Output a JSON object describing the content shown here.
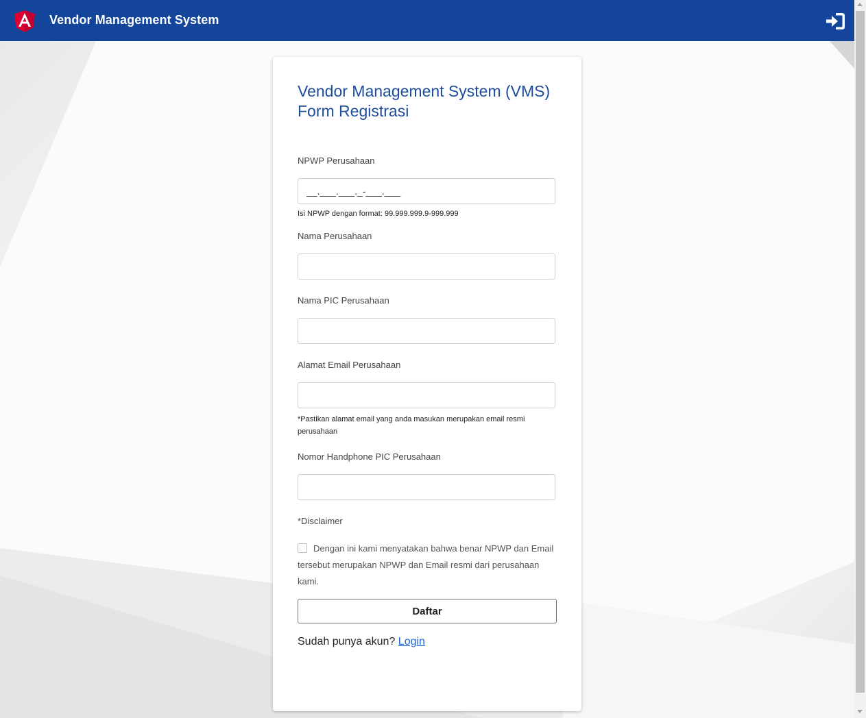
{
  "navbar": {
    "brand_title": "Vendor Management System",
    "logo_icon": "angular-logo-icon",
    "signin_icon": "sign-in-icon",
    "color": "#13459a"
  },
  "form": {
    "title_line1": "Vendor Management System (VMS)",
    "title_line2": "Form Registrasi",
    "npwp_label": "NPWP Perusahaan",
    "npwp_placeholder": "__.___.___._-___.___",
    "npwp_hint": "Isi NPWP dengan format: 99.999.999.9-999.999",
    "company_name_label": "Nama Perusahaan",
    "company_name_value": "",
    "pic_name_label": "Nama PIC Perusahaan",
    "pic_name_value": "",
    "email_label": "Alamat Email Perusahaan",
    "email_value": "",
    "email_hint": "*Pastikan alamat email yang anda masukan merupakan email resmi perusahaan",
    "phone_label": "Nomor Handphone PIC Perusahaan",
    "phone_value": "",
    "disclaimer_label": "*Disclaimer",
    "disclaimer_text": "Dengan ini kami menyatakan bahwa benar NPWP dan Email tersebut merupakan NPWP dan Email resmi dari perusahaan kami.",
    "disclaimer_checked": false,
    "submit_label": "Daftar",
    "login_prompt": "Sudah punya akun?",
    "login_link": "Login"
  },
  "colors": {
    "title": "#1e4d9b",
    "link": "#1a66d6"
  }
}
